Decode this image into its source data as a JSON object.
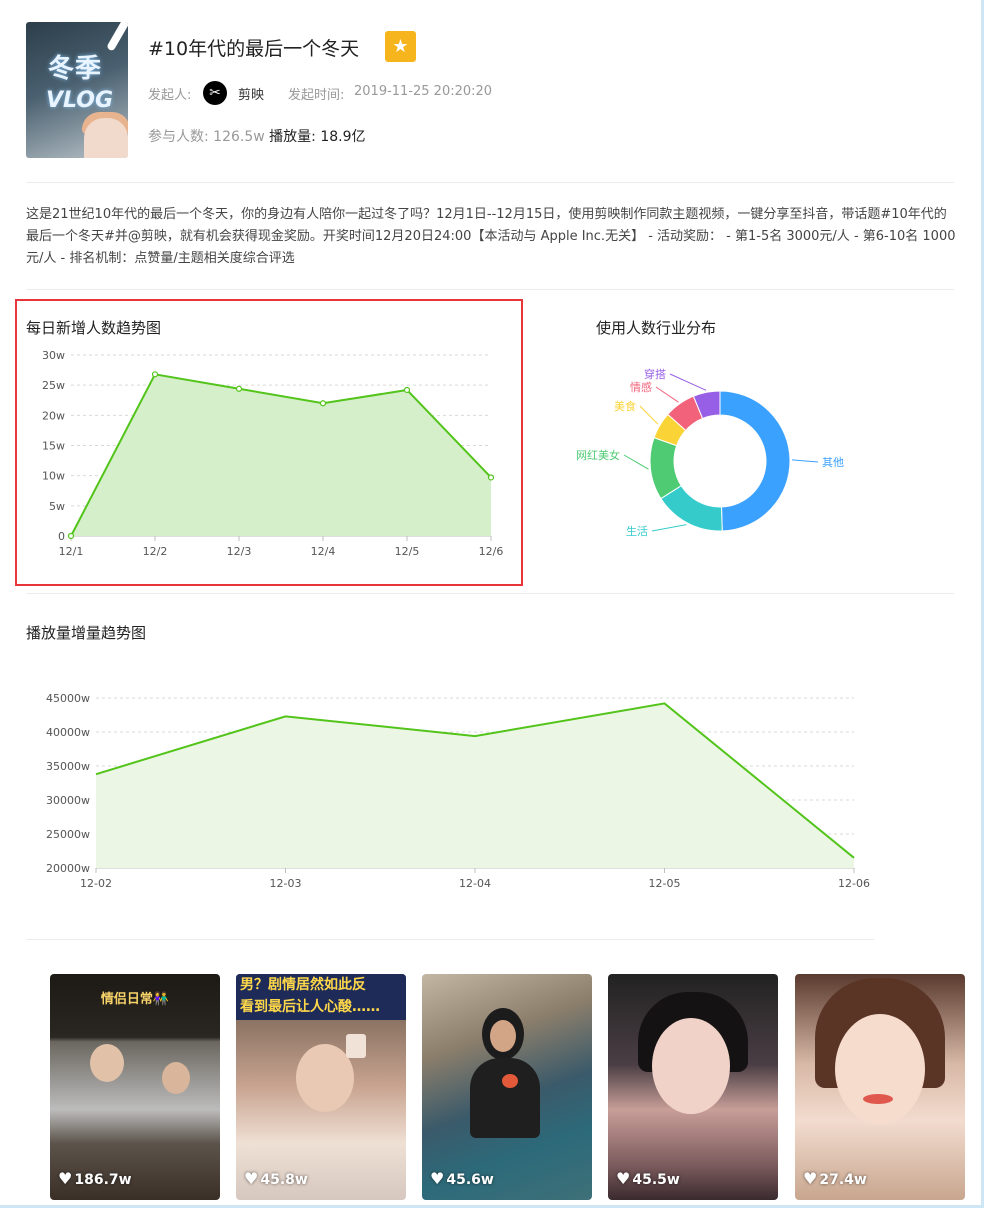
{
  "header": {
    "title": "#10年代的最后一个冬天",
    "cover_text_1": "冬季",
    "cover_text_2": "VLOG",
    "initiator_label": "发起人:",
    "initiator_name": "剪映",
    "start_time_label": "发起时间:",
    "start_time": "2019-11-25 20:20:20",
    "participants_label": "参与人数:",
    "participants": "126.5w",
    "plays_label": "播放量:",
    "plays": "18.9亿"
  },
  "description": "这是21世纪10年代的最后一个冬天，你的身边有人陪你一起过冬了吗？12月1日--12月15日，使用剪映制作同款主题视频，一键分享至抖音，带话题#10年代的最后一个冬天#并@剪映，就有机会获得现金奖励。开奖时间12月20日24:00【本活动与 Apple Inc.无关】 - 活动奖励：  - 第1-5名 3000元/人 - 第6-10名 1000元/人 - 排名机制：点赞量/主题相关度综合评选",
  "daily_chart": {
    "title": "每日新增人数趋势图"
  },
  "industry_chart": {
    "title": "使用人数行业分布"
  },
  "plays_chart": {
    "title": "播放量增量趋势图"
  },
  "chart_data": [
    {
      "type": "area",
      "title": "每日新增人数趋势图",
      "categories": [
        "12/1",
        "12/2",
        "12/3",
        "12/4",
        "12/5",
        "12/6"
      ],
      "values": [
        0,
        26.8,
        24.4,
        22,
        24.2,
        9.7
      ],
      "ylim": [
        0,
        30
      ],
      "yticks": [
        "0",
        "5w",
        "10w",
        "15w",
        "20w",
        "25w",
        "30w"
      ],
      "color": "#52c41a",
      "grid": true
    },
    {
      "type": "pie",
      "title": "使用人数行业分布",
      "labels": [
        "其他",
        "生活",
        "网红美女",
        "美食",
        "情感",
        "穿搭"
      ],
      "values": [
        48,
        16,
        14,
        6,
        7,
        6
      ],
      "colors": [
        "#3ba1ff",
        "#36cbcb",
        "#4ecb73",
        "#fad337",
        "#f2637b",
        "#975fe5"
      ],
      "donut": true
    },
    {
      "type": "area",
      "title": "播放量增量趋势图",
      "categories": [
        "12-02",
        "12-03",
        "12-04",
        "12-05",
        "12-06"
      ],
      "values": [
        33800,
        42300,
        39400,
        44200,
        21500
      ],
      "ylim": [
        20000,
        45000
      ],
      "yticks": [
        "20000w",
        "25000w",
        "30000w",
        "35000w",
        "40000w",
        "45000w"
      ],
      "color": "#52c41a",
      "grid": true
    }
  ],
  "videos": [
    {
      "likes": "186.7w",
      "caption": "情侣日常👫"
    },
    {
      "likes": "45.8w",
      "banner_1": "男？剧情居然如此反",
      "banner_2": "看到最后让人心酸……"
    },
    {
      "likes": "45.6w"
    },
    {
      "likes": "45.5w"
    },
    {
      "likes": "27.4w"
    }
  ]
}
